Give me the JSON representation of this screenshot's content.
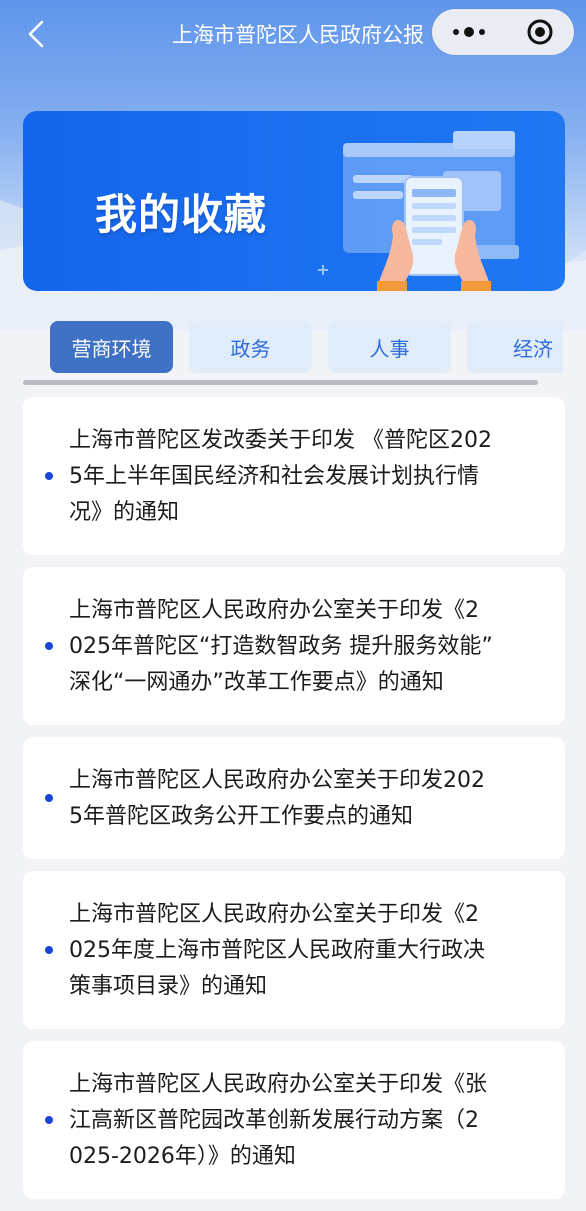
{
  "header": {
    "title": "上海市普陀区人民政府公报",
    "back_icon": "chevron-left-icon",
    "more_icon": "more-dots-icon",
    "close_icon": "target-circle-icon"
  },
  "banner": {
    "title": "我的收藏",
    "illustration": "hands-holding-phone-illustration"
  },
  "tabs": [
    {
      "label": "营商环境",
      "active": true
    },
    {
      "label": "政务",
      "active": false
    },
    {
      "label": "人事",
      "active": false
    },
    {
      "label": "经济",
      "active": false
    }
  ],
  "items": [
    {
      "title": "上海市普陀区发改委关于印发 《普陀区202\n5年上半年国民经济和社会发展计划执行情\n况》的通知"
    },
    {
      "title": "上海市普陀区人民政府办公室关于印发《2\n025年普陀区“打造数智政务 提升服务效能”\n深化“一网通办”改革工作要点》的通知"
    },
    {
      "title": "上海市普陀区人民政府办公室关于印发202\n5年普陀区政务公开工作要点的通知"
    },
    {
      "title": "上海市普陀区人民政府办公室关于印发《2\n025年度上海市普陀区人民政府重大行政决\n策事项目录》的通知"
    },
    {
      "title": "上海市普陀区人民政府办公室关于印发《张\n江高新区普陀园改革创新发展行动方案（2\n025-2026年）》的通知"
    }
  ],
  "colors": {
    "accent": "#1f78f2",
    "tab_active": "#3f72c4",
    "tab_inactive": "#e1ecfb",
    "bullet": "#1845d9"
  }
}
